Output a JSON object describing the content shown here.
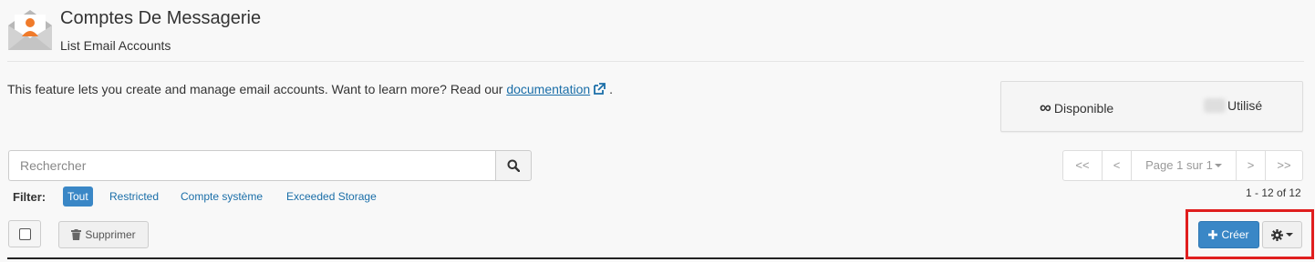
{
  "header": {
    "title": "Comptes De Messagerie",
    "subtitle": "List Email Accounts",
    "icon": "envelope-user-icon"
  },
  "description": {
    "text": "This feature lets you create and manage email accounts. Want to learn more? Read our ",
    "link_label": "documentation",
    "suffix": "."
  },
  "stats": {
    "available_symbol": "∞",
    "available_label": "Disponible",
    "used_label": "Utilisé"
  },
  "search": {
    "placeholder": "Rechercher",
    "icon": "search-icon"
  },
  "filter": {
    "label": "Filter:",
    "options": [
      "Tout",
      "Restricted",
      "Compte système",
      "Exceeded Storage"
    ],
    "active": "Tout"
  },
  "pagination": {
    "first": "<<",
    "prev": "<",
    "page_label": "Page 1 sur 1",
    "next": ">",
    "last": ">>",
    "range": "1 - 12 of 12"
  },
  "toolbar": {
    "delete_label": "Supprimer",
    "create_label": "Créer"
  },
  "colors": {
    "primary": "#3a87c6",
    "link": "#1a6ea8",
    "highlight": "#e01e1e",
    "avatar_orange": "#f07b2b"
  }
}
